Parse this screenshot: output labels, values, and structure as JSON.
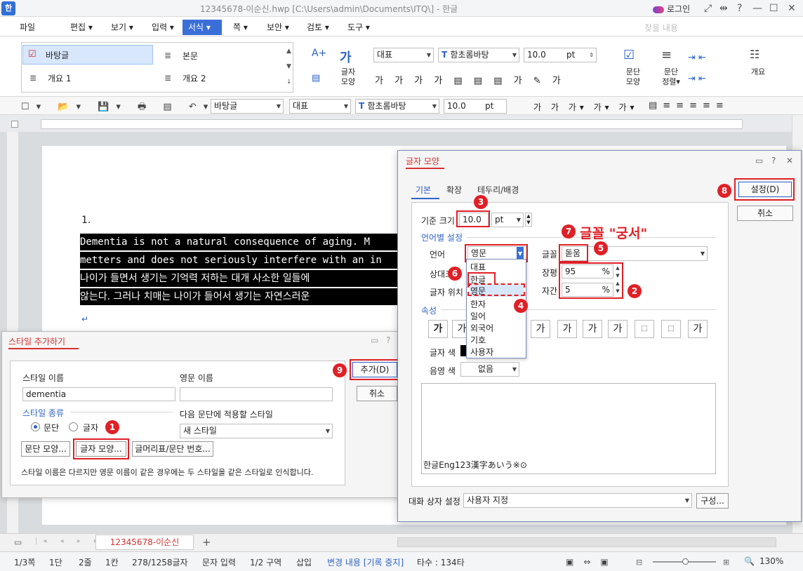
{
  "titlebar": {
    "app_logo": "한",
    "title": "12345678-이순신.hwp [C:\\Users\\admin\\Documents\\ITQ\\] - 한글",
    "login": "로그인"
  },
  "menu": {
    "items": [
      "파일",
      "편집 ▾",
      "보기 ▾",
      "입력 ▾",
      "쪽 ▾",
      "보안 ▾",
      "검토 ▾",
      "도구 ▾"
    ],
    "active": "서식 ▾",
    "search_placeholder": "찾을 내용"
  },
  "ribbon": {
    "styles": [
      "바탕글",
      "본문",
      "개요 1",
      "개요 2"
    ],
    "char_shape": "글자\n모양",
    "para_shape": "문단\n모양",
    "para_align": "문단\n정렬▾",
    "outline": "개요",
    "style_combo": "대표",
    "font_combo": "함초롬바탕",
    "size_combo": "10.0",
    "size_unit": "pt"
  },
  "toolbar2": {
    "style_combo": "바탕글",
    "lang_combo": "대표",
    "font_combo": "함초롬바탕",
    "size_combo": "10.0",
    "size_unit": "pt"
  },
  "document": {
    "list_number": "1.",
    "lines": [
      "Dementia is not a natural consequence of aging. M",
      "metters and does not seriously interfere with an in",
      "나이가 들면서 생기는 기억력 저하는 대개 사소한 일들에",
      "않는다. 그러나 치매는 나이가 들어서 생기는 자연스러운"
    ]
  },
  "style_dialog": {
    "title": "스타일 추가하기",
    "style_name_label": "스타일 이름",
    "style_name_value": "dementia",
    "eng_name_label": "영문 이름",
    "eng_name_value": "",
    "kind_label": "스타일 종류",
    "kind_para": "문단",
    "kind_char": "글자",
    "next_style_label": "다음 문단에 적용할 스타일",
    "next_style_value": "새 스타일",
    "btn_para_shape": "문단 모양...",
    "btn_char_shape": "글자 모양...",
    "btn_bullet": "글머리표/문단 번호...",
    "note": "스타일 이름은 다르지만 영문 이름이 같은 경우에는 두 스타일을 같은 스타일로 인식합니다.",
    "btn_add": "추가(D)",
    "btn_cancel": "취소"
  },
  "char_dialog": {
    "title": "글자 모양",
    "tabs": [
      "기본",
      "확장",
      "테두리/배경"
    ],
    "base_size_label": "기준 크기",
    "base_size_value": "10.0",
    "base_size_unit": "pt",
    "lang_section": "언어별 설정",
    "lang_label": "언어",
    "lang_value": "영문",
    "font_label": "글꼴",
    "font_value": "돋움",
    "rel_size_label": "상대크",
    "width_label": "장평",
    "width_value": "95",
    "spacing_label": "자간",
    "spacing_value": "5",
    "pos_label": "글자 위치",
    "percent": "%",
    "attr_section": "속성",
    "attr_glyph": "가",
    "color_label": "글자 색",
    "shade_label": "음영 색",
    "shade_value": "없음",
    "preview_text": "한글Eng123漢字あいう※⊙",
    "dialog_setting_label": "대화 상자 설정",
    "dialog_setting_value": "사용자 지정",
    "btn_config": "구성...",
    "btn_set": "설정(D)",
    "btn_cancel": "취소",
    "dropdown_items": [
      "대표",
      "한글",
      "영문",
      "한자",
      "일어",
      "외국어",
      "기호",
      "사용자"
    ]
  },
  "annotations": {
    "badges": [
      "1",
      "2",
      "3",
      "4",
      "5",
      "6",
      "7",
      "8",
      "9"
    ],
    "font_note": "글꼴 \"궁서\""
  },
  "tabbar": {
    "doc_tab": "12345678-이순신"
  },
  "status": {
    "page": "1/3쪽",
    "col": "1단",
    "line": "2줄",
    "kan": "1칸",
    "chars": "278/1258글자",
    "mode": "문자 입력",
    "section": "1/2 구역",
    "insert": "삽입",
    "track": "변경 내용 [기록 중지]",
    "typing": "타수 : 134타",
    "zoom": "130%"
  },
  "colors": {
    "accent": "#3a6fd8",
    "annotation_red": "#e01f26",
    "tab_blue": "#2d63c8"
  }
}
